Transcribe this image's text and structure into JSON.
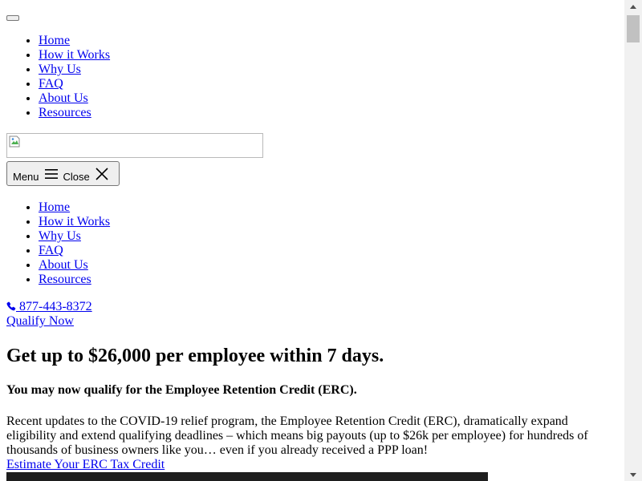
{
  "nav_primary": [
    "Home",
    "How it Works",
    "Why Us",
    "FAQ",
    "About Us",
    "Resources"
  ],
  "nav_secondary": [
    "Home",
    "How it Works",
    "Why Us",
    "FAQ",
    "About Us",
    "Resources"
  ],
  "menu_button": {
    "menu_label": "Menu",
    "close_label": "Close"
  },
  "contact": {
    "phone": "877-443-8372",
    "phone_icon": "phone-icon"
  },
  "cta": {
    "qualify": "Qualify Now",
    "estimate": "Estimate Your ERC Tax Credit"
  },
  "hero": {
    "headline": "Get up to $26,000 per employee within 7 days.",
    "subheadline": "You may now qualify for the Employee Retention Credit (ERC).",
    "body": "Recent updates to the COVID-19 relief program, the Employee Retention Credit (ERC), dramatically expand eligibility and extend qualifying deadlines – which means big payouts (up to $26k per employee) for hundreds of thousands of business owners like you… even if you already received a PPP loan!"
  },
  "colors": {
    "link": "#0000ee",
    "button_bg": "#efefef",
    "scroll_thumb": "#c1c1c1"
  }
}
